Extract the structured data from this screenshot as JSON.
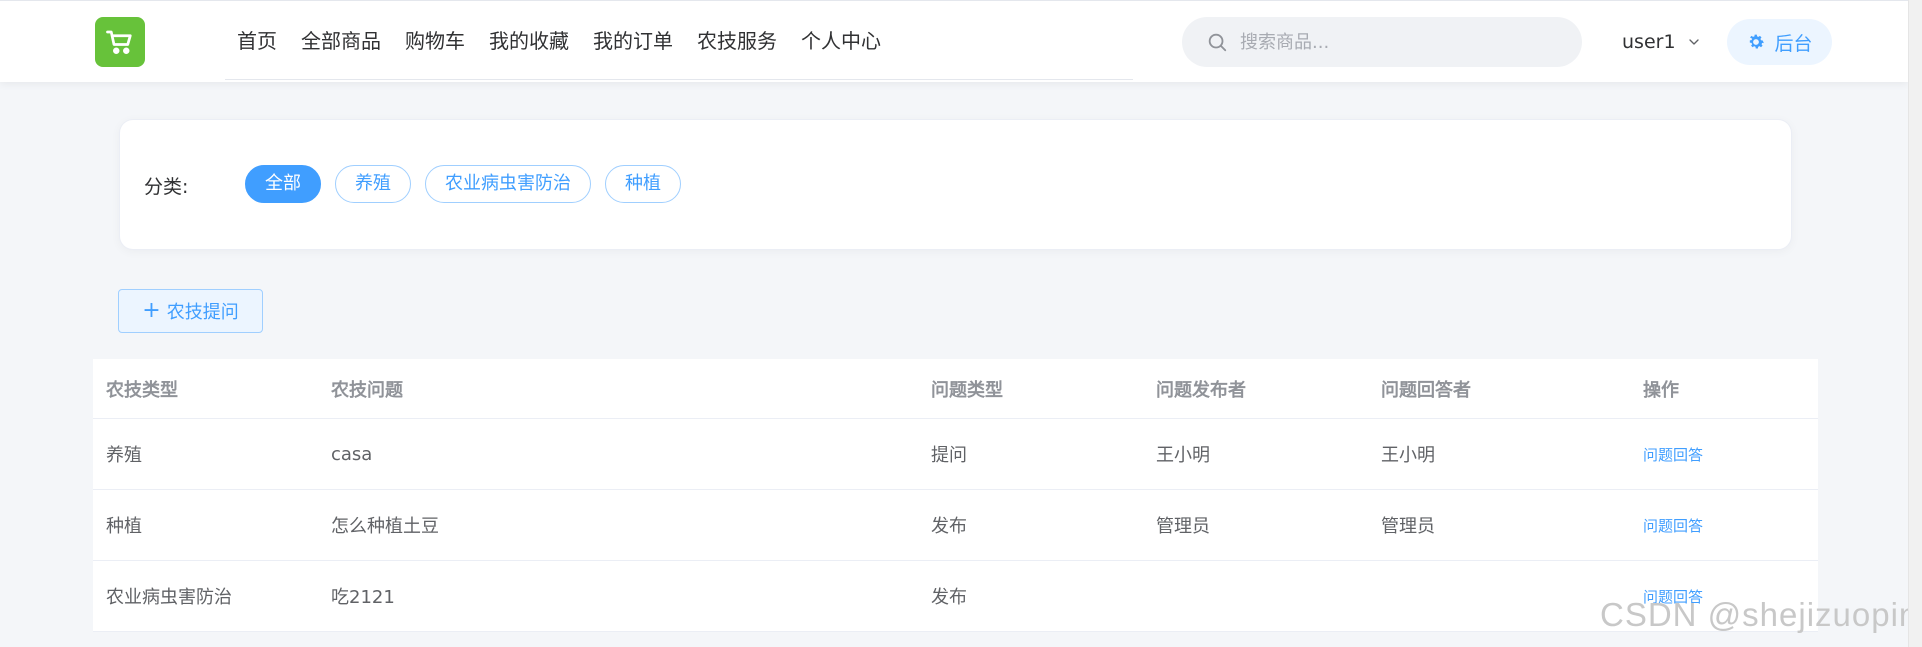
{
  "nav": {
    "items": [
      "首页",
      "全部商品",
      "购物车",
      "我的收藏",
      "我的订单",
      "农技服务",
      "个人中心"
    ],
    "active_index": 5
  },
  "search": {
    "placeholder": "搜索商品..."
  },
  "user": {
    "name": "user1"
  },
  "admin": {
    "label": "后台"
  },
  "category": {
    "label": "分类:",
    "tags": [
      "全部",
      "养殖",
      "农业病虫害防治",
      "种植"
    ],
    "active_index": 0
  },
  "ask_button": {
    "label": "农技提问"
  },
  "table": {
    "headers": [
      "农技类型",
      "农技问题",
      "问题类型",
      "问题发布者",
      "问题回答者",
      "操作"
    ],
    "rows": [
      [
        "养殖",
        "casa",
        "提问",
        "王小明",
        "王小明",
        "问题回答"
      ],
      [
        "种植",
        "怎么种植土豆",
        "发布",
        "管理员",
        "管理员",
        "问题回答"
      ],
      [
        "农业病虫害防治",
        "吃2121",
        "发布",
        "",
        "",
        "问题回答"
      ]
    ]
  },
  "watermark": "CSDN @shejizuopin",
  "colors": {
    "brand": "#67c23a",
    "primary": "#409eff"
  },
  "icons": {
    "logo": "shopping-cart-icon",
    "search": "search-icon",
    "user_menu": "chevron-down-icon",
    "admin": "gear-icon",
    "ask": "plus-icon"
  }
}
